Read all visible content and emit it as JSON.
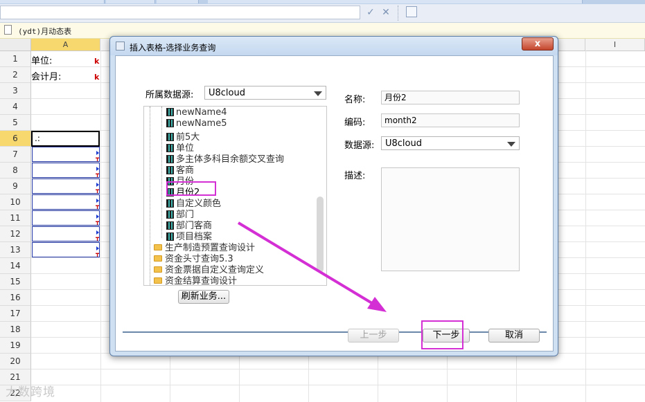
{
  "formula_bar": {
    "confirm_icon": "check-icon",
    "cancel_icon": "x-icon",
    "fx_icon": "image-icon"
  },
  "document": {
    "title": "(ydt)月动态表"
  },
  "sheet": {
    "columns": [
      "A",
      "",
      "",
      "",
      "",
      "",
      "",
      "",
      "I"
    ],
    "rows": [
      "1",
      "2",
      "3",
      "4",
      "5",
      "6",
      "7",
      "8",
      "9",
      "10",
      "11",
      "12",
      "13",
      "14",
      "15",
      "16",
      "17",
      "18",
      "19",
      "20",
      "21",
      "22"
    ],
    "cells": {
      "a1": "单位:",
      "a2": "会计月:",
      "a6": ".:",
      "k": "k"
    },
    "watermark": "大数跨境"
  },
  "dialog": {
    "title": "插入表格-选择业务查询",
    "close": "x",
    "datasource_label": "所属数据源:",
    "datasource_value": "U8cloud",
    "tree_items": [
      "newName4",
      "newName5",
      "前5大",
      "单位",
      "多主体多科目余额交叉查询",
      "客商",
      "月份",
      "月份2",
      "自定义颜色",
      "部门",
      "部门客商",
      "项目档案"
    ],
    "tree_folders": [
      "生产制造预置查询设计",
      "资金头寸查询5.3",
      "资金票据自定义查询定义",
      "资金结算查询设计"
    ],
    "refresh_button": "刷新业务...",
    "name_label": "名称:",
    "name_value": "月份2",
    "code_label": "编码:",
    "code_value": "month2",
    "source_label": "数据源:",
    "source_value": "U8cloud",
    "desc_label": "描述:",
    "prev_button": "上一步",
    "next_button": "下一步",
    "cancel_button": "取消"
  },
  "colors": {
    "highlight": "#d42fd4",
    "selected_row": "#f7d86e"
  }
}
